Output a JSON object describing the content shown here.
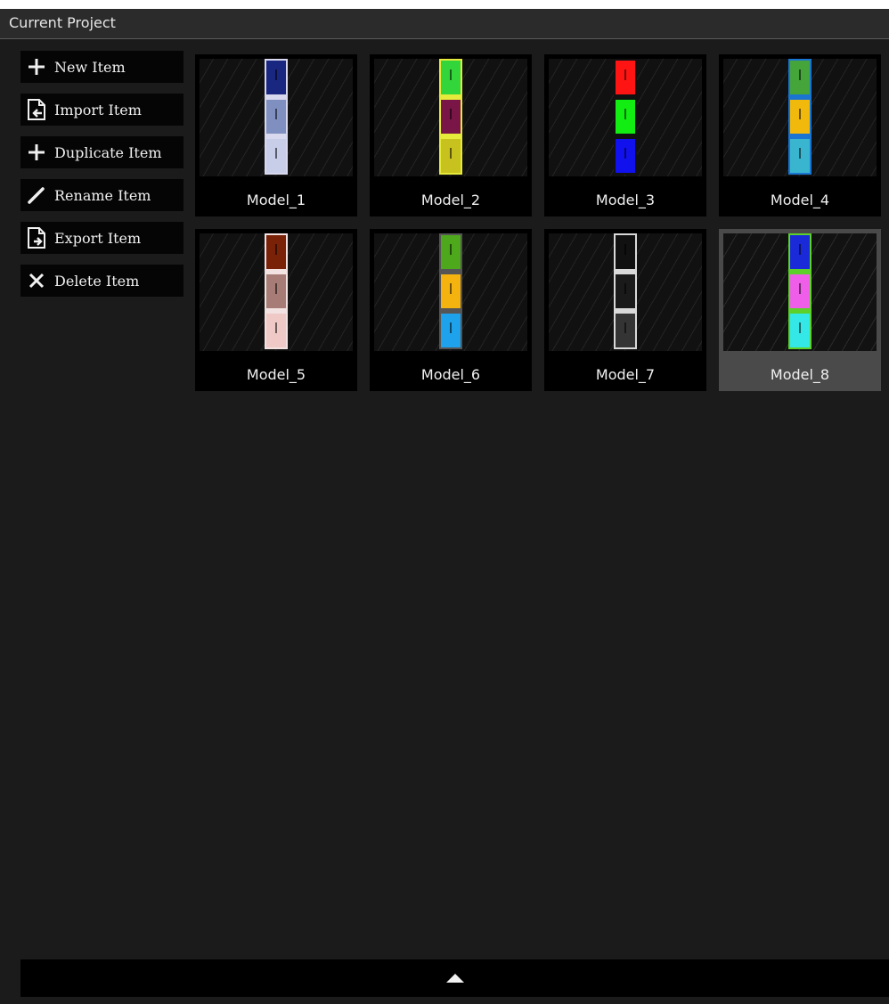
{
  "panel": {
    "title": "Current Project"
  },
  "actions": [
    {
      "label": "New Item",
      "icon": "plus-icon"
    },
    {
      "label": "Import Item",
      "icon": "import-file-icon"
    },
    {
      "label": "Duplicate Item",
      "icon": "plus-icon"
    },
    {
      "label": "Rename Item",
      "icon": "pencil-icon"
    },
    {
      "label": "Export Item",
      "icon": "export-file-icon"
    },
    {
      "label": "Delete Item",
      "icon": "close-icon"
    }
  ],
  "models": [
    {
      "label": "Model_1",
      "frame": "#d8d8ee",
      "swatches": [
        "#1a2780",
        "#7f8fc0",
        "#c8cde8"
      ]
    },
    {
      "label": "Model_2",
      "frame": "#e6ea3a",
      "swatches": [
        "#33d63a",
        "#7a1547",
        "#c8c21e"
      ]
    },
    {
      "label": "Model_3",
      "frame": "#111111",
      "swatches": [
        "#ff1414",
        "#12ee12",
        "#1111ee"
      ]
    },
    {
      "label": "Model_4",
      "frame": "#1a74d1",
      "swatches": [
        "#45a53a",
        "#f2b90d",
        "#3ab5d0"
      ]
    },
    {
      "label": "Model_5",
      "frame": "#f2e2e2",
      "swatches": [
        "#7a2208",
        "#a77c76",
        "#efc9c5"
      ]
    },
    {
      "label": "Model_6",
      "frame": "#555555",
      "swatches": [
        "#4ea81b",
        "#f5b30f",
        "#1ea2ec"
      ]
    },
    {
      "label": "Model_7",
      "frame": "#d9d9d9",
      "swatches": [
        "#111111",
        "#1a1a1a",
        "#343434"
      ]
    },
    {
      "label": "Model_8",
      "frame": "#5bd12a",
      "swatches": [
        "#1a2ad8",
        "#ee5ee8",
        "#35e8e8"
      ],
      "selected": true
    }
  ],
  "footer": {
    "icon": "chevron-up-icon"
  }
}
